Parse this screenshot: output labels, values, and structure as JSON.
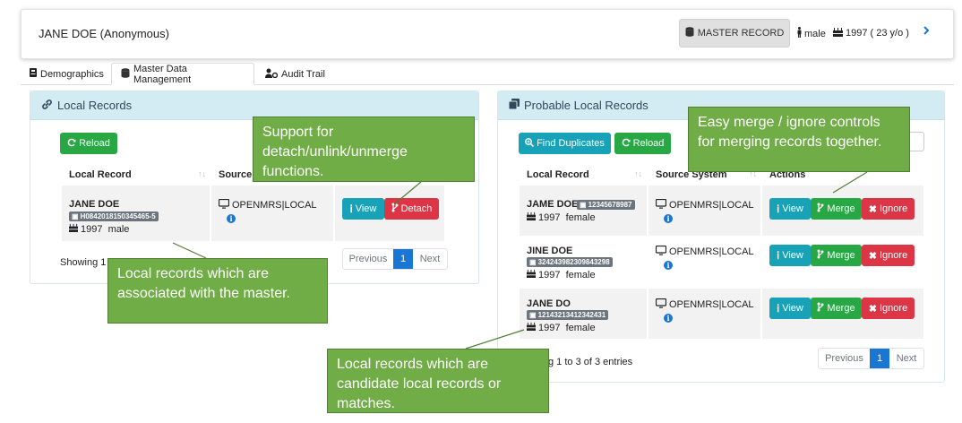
{
  "header": {
    "patient_name": "JANE DOE (Anonymous)",
    "master_badge": "MASTER RECORD",
    "gender": "male",
    "birth": "1997 ( 23 y/o )"
  },
  "tabs": [
    {
      "label": "Demographics"
    },
    {
      "label": "Master Data Management"
    },
    {
      "label": "Audit Trail"
    }
  ],
  "local_panel": {
    "title": "Local Records",
    "reload_label": "Reload",
    "columns": [
      "Local Record",
      "Source S"
    ],
    "rows": [
      {
        "name": "JANE DOE",
        "id": "H0842018150345465-5",
        "info": "1997  male",
        "source": "OPENMRS|LOCAL",
        "view_label": "View",
        "detach_label": "Detach"
      }
    ],
    "showing": "Showing 1",
    "pager": {
      "prev": "Previous",
      "page": "1",
      "next": "Next"
    }
  },
  "probable_panel": {
    "title": "Probable Local Records",
    "find_label": "Find Duplicates",
    "reload_label": "Reload",
    "columns": [
      "Local Record",
      "Source System",
      "Actions"
    ],
    "rows": [
      {
        "name": "JAME DOE",
        "id": "12345678987",
        "info": "1997  female",
        "source": "OPENMRS|LOCAL",
        "view_label": "View",
        "merge_label": "Merge",
        "ignore_label": "Ignore"
      },
      {
        "name": "JINE DOE",
        "id": "324243982309843298",
        "info": "1997  female",
        "source": "OPENMRS|LOCAL",
        "view_label": "View",
        "merge_label": "Merge",
        "ignore_label": "Ignore"
      },
      {
        "name": "JANE DO",
        "id": "12143213412342431",
        "info": "1997  female",
        "source": "OPENMRS|LOCAL",
        "view_label": "View",
        "merge_label": "Merge",
        "ignore_label": "Ignore"
      }
    ],
    "showing": "g 1 to 3 of 3 entries",
    "pager": {
      "prev": "Previous",
      "page": "1",
      "next": "Next"
    }
  },
  "callouts": {
    "detach": "Support for detach/unlink/unmerge functions.",
    "merge": "Easy merge / ignore controls for merging records together.",
    "local": "Local records which are associated with the master.",
    "candidate": "Local records which are candidate local records or matches."
  },
  "colors": {
    "success": "#28a745",
    "info": "#17a2b8",
    "danger": "#dc3545",
    "primary": "#1976d2",
    "callout": "#70ad47",
    "panel_heading": "#d3ebf2"
  }
}
